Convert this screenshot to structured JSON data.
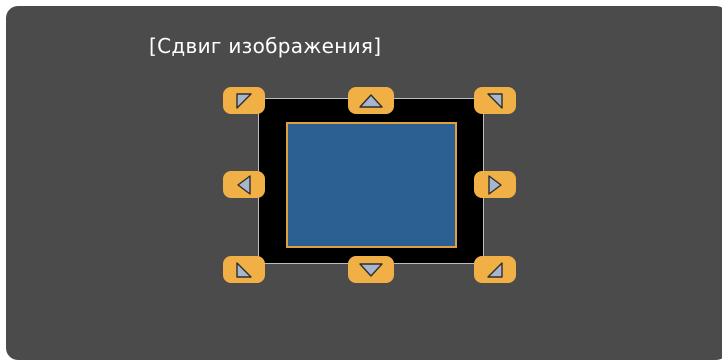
{
  "dialog": {
    "title": "[Сдвиг изображения]"
  },
  "colors": {
    "panel_background": "#4b4b4b",
    "button_fill": "#f0b046",
    "arrow_fill": "#a6b6cc",
    "arrow_outline": "#2e2e2e",
    "image_fill": "#2c5f92",
    "image_border": "#e0a03e",
    "frame_fill": "#000000"
  },
  "controls": {
    "arrows": [
      {
        "direction": "up-left",
        "icon": "arrow-up-left-icon"
      },
      {
        "direction": "up",
        "icon": "arrow-up-icon"
      },
      {
        "direction": "up-right",
        "icon": "arrow-up-right-icon"
      },
      {
        "direction": "left",
        "icon": "arrow-left-icon"
      },
      {
        "direction": "right",
        "icon": "arrow-right-icon"
      },
      {
        "direction": "down-left",
        "icon": "arrow-down-left-icon"
      },
      {
        "direction": "down",
        "icon": "arrow-down-icon"
      },
      {
        "direction": "down-right",
        "icon": "arrow-down-right-icon"
      }
    ]
  }
}
